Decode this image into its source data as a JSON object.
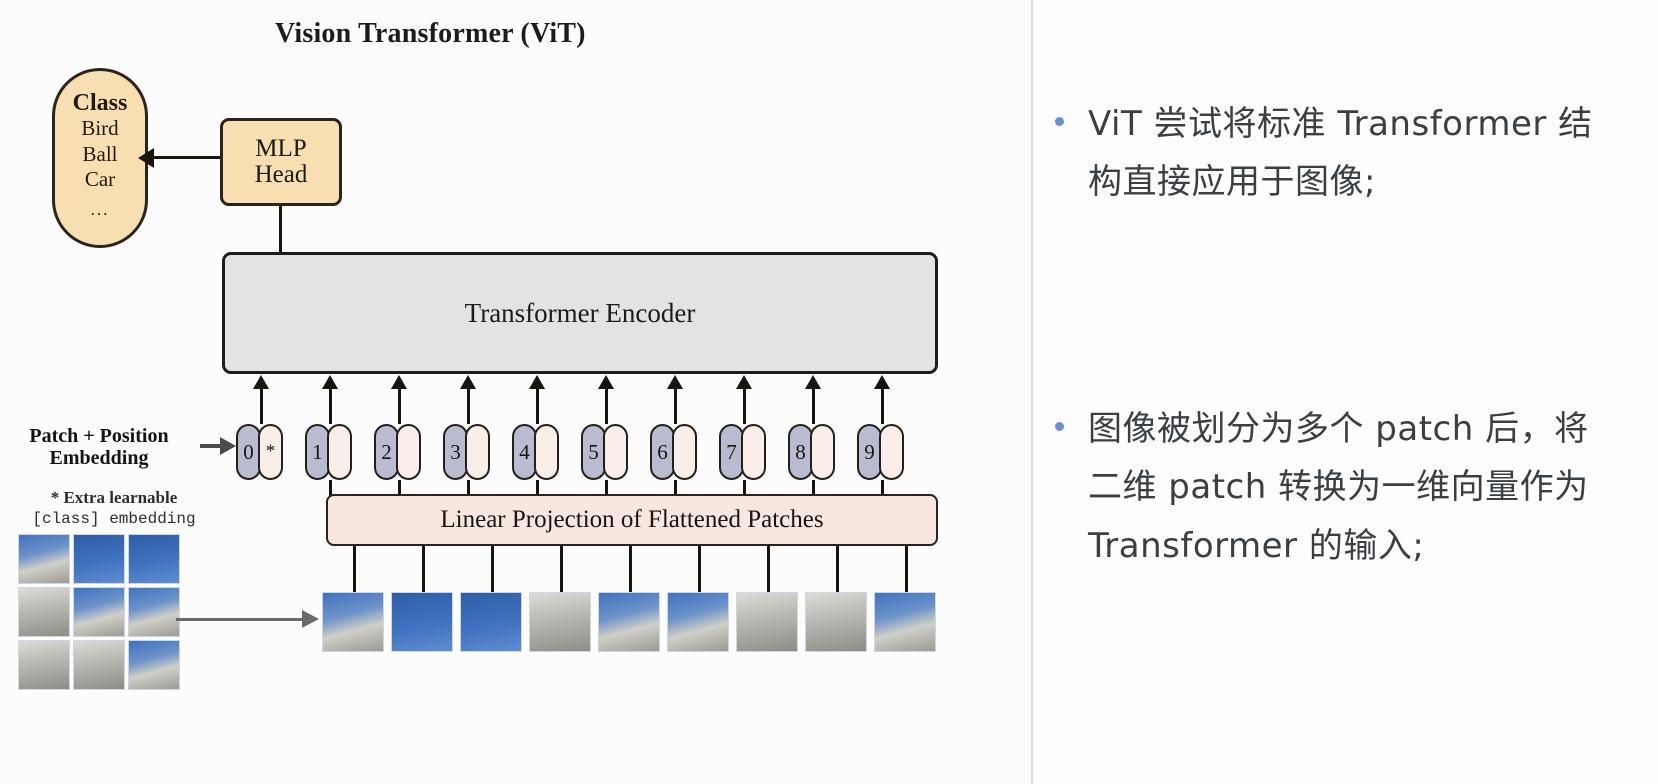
{
  "diagram": {
    "title": "Vision Transformer (ViT)",
    "class_box": {
      "header": "Class",
      "options": [
        "Bird",
        "Ball",
        "Car"
      ],
      "ellipsis": "..."
    },
    "mlp_head": {
      "line1": "MLP",
      "line2": "Head"
    },
    "encoder": {
      "label": "Transformer Encoder"
    },
    "linear_projection": {
      "label": "Linear Projection of Flattened Patches"
    },
    "patch_position_label": {
      "line1": "Patch + Position",
      "line2": "Embedding"
    },
    "footnote": {
      "line1": "* Extra learnable",
      "line2": "[class] embedding"
    },
    "tokens": [
      {
        "pos": "0",
        "emb": "*"
      },
      {
        "pos": "1",
        "emb": ""
      },
      {
        "pos": "2",
        "emb": ""
      },
      {
        "pos": "3",
        "emb": ""
      },
      {
        "pos": "4",
        "emb": ""
      },
      {
        "pos": "5",
        "emb": ""
      },
      {
        "pos": "6",
        "emb": ""
      },
      {
        "pos": "7",
        "emb": ""
      },
      {
        "pos": "8",
        "emb": ""
      },
      {
        "pos": "9",
        "emb": ""
      }
    ],
    "colors": {
      "class_fill": "#f7dfb1",
      "mlp_fill": "#f7dfb1",
      "encoder_fill": "#e3e3e3",
      "linear_fill": "#f8e6e0",
      "position_token_fill": "#b9bcd0",
      "embedding_token_fill": "#faeee8",
      "outline": "#23201b"
    }
  },
  "notes": {
    "bullets": [
      "ViT 尝试将标准 Transformer 结构直接应用于图像;",
      "图像被划分为多个 patch 后，将二维 patch 转换为一维向量作为 Transformer 的输入;"
    ],
    "bullet_color": "#6b8ed6"
  }
}
